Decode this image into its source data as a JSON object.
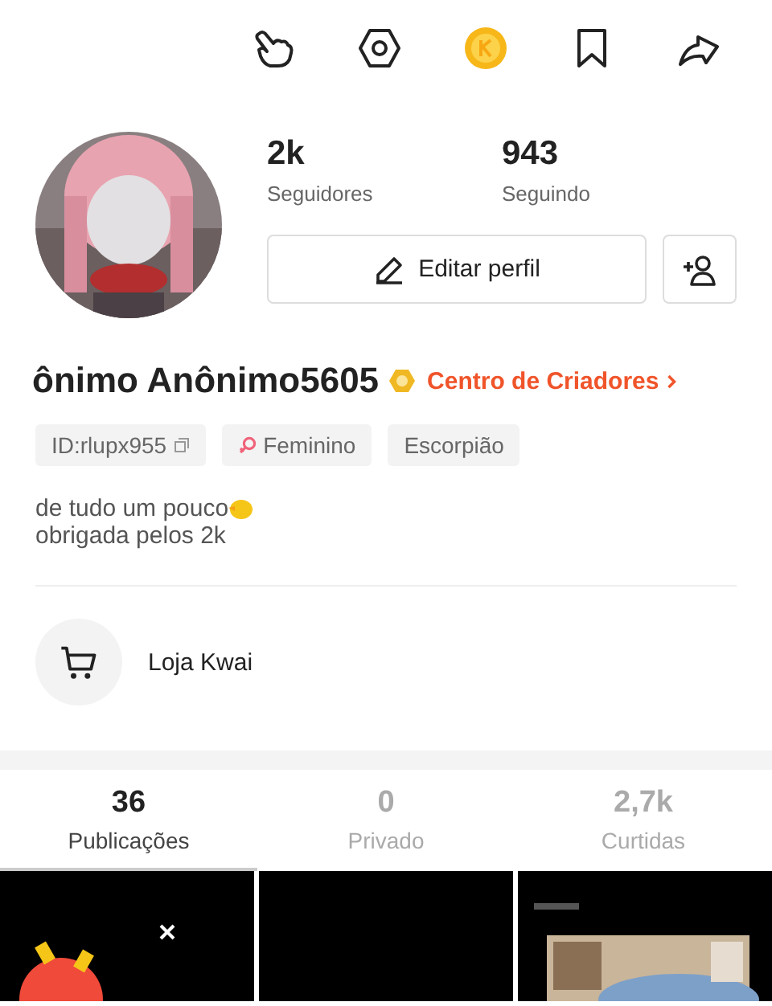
{
  "top_bar": {
    "icons": [
      {
        "kind": "hand"
      },
      {
        "kind": "settings"
      },
      {
        "kind": "coin"
      },
      {
        "kind": "bookmark"
      },
      {
        "kind": "share"
      }
    ]
  },
  "profile": {
    "stats": [
      {
        "value": "2k",
        "label": "Seguidores"
      },
      {
        "value": "943",
        "label": "Seguindo"
      }
    ],
    "edit_button": "Editar perfil",
    "name": "ônimo Anônimo5605",
    "creator_link": "Centro de Criadores",
    "tags": [
      {
        "kind": "id",
        "label": "ID:rlupx955"
      },
      {
        "kind": "gender",
        "label": "Feminino"
      },
      {
        "kind": "plain",
        "label": "Escorpião"
      }
    ],
    "bio": [
      "de tudo um pouco",
      "obrigada pelos 2k"
    ]
  },
  "shop": {
    "label": "Loja Kwai"
  },
  "tabs": [
    {
      "count": "36",
      "label": "Publicações",
      "selected": true
    },
    {
      "count": "0",
      "label": "Privado",
      "selected": false
    },
    {
      "count": "2,7k",
      "label": "Curtidas",
      "selected": false
    }
  ]
}
